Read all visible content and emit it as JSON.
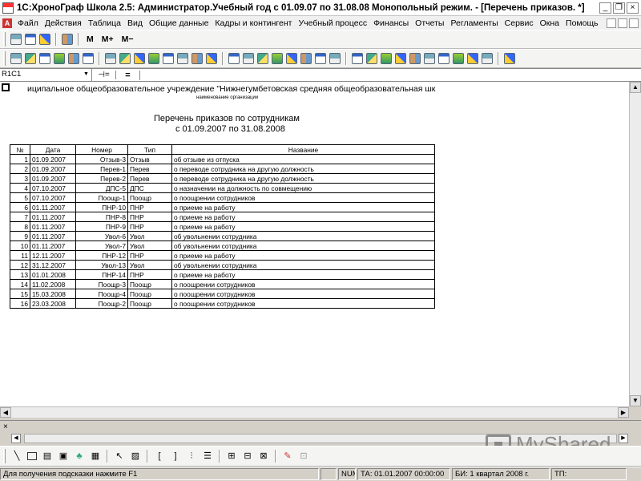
{
  "window": {
    "title": "1С:ХроноГраф Школа 2.5: Администратор.Учебный год с 01.09.07 по 31.08.08 Монопольный режим. - [Перечень приказов. *]",
    "minimize": "_",
    "restore": "❐",
    "close": "×"
  },
  "menu": {
    "items": [
      "Файл",
      "Действия",
      "Таблица",
      "Вид",
      "Общие данные",
      "Кадры и контингент",
      "Учебный процесс",
      "Финансы",
      "Отчеты",
      "Регламенты",
      "Сервис",
      "Окна",
      "Помощь"
    ],
    "doc_icon": "A"
  },
  "toolbar": {
    "m_label": "M",
    "m_plus_label": "M+",
    "m_minus_label": "M−"
  },
  "formula_bar": {
    "cell_ref": "R1C1",
    "pin": "⊣=",
    "equals": "="
  },
  "report": {
    "organization": "иципальное общеобразовательное учреждение \"Нижнегумбетовская средняя общеобразовательная шк",
    "organization_caption": "наименование организации",
    "title": "Перечень приказов по сотрудникам",
    "period": "с 01.09.2007 по 31.08.2008",
    "headers": [
      "№",
      "Дата",
      "Номер",
      "Тип",
      "Название"
    ],
    "rows": [
      [
        "1",
        "01.09.2007",
        "Отзыв-3",
        "Отзыв",
        "об отзыве из отпуска"
      ],
      [
        "2",
        "01.09.2007",
        "Перев-1",
        "Перев",
        "о переводе сотрудника на другую должность"
      ],
      [
        "3",
        "01.09.2007",
        "Перев-2",
        "Перев",
        "о переводе сотрудника на другую должность"
      ],
      [
        "4",
        "07.10.2007",
        "ДПС-5",
        "ДПС",
        "о назначении на должность по совмещению"
      ],
      [
        "5",
        "07.10.2007",
        "Поощр-1",
        "Поощр",
        "о поощрении сотрудников"
      ],
      [
        "6",
        "01.11.2007",
        "ПНР-10",
        "ПНР",
        "о приеме на работу"
      ],
      [
        "7",
        "01.11.2007",
        "ПНР-8",
        "ПНР",
        "о приеме на работу"
      ],
      [
        "8",
        "01.11.2007",
        "ПНР-9",
        "ПНР",
        "о приеме на работу"
      ],
      [
        "9",
        "01.11.2007",
        "Увол-6",
        "Увол",
        "об увольнении сотрудника"
      ],
      [
        "10",
        "01.11.2007",
        "Увол-7",
        "Увол",
        "об увольнении сотрудника"
      ],
      [
        "11",
        "12.11.2007",
        "ПНР-12",
        "ПНР",
        "о приеме на работу"
      ],
      [
        "12",
        "31.12.2007",
        "Увол-13",
        "Увол",
        "об увольнении сотрудника"
      ],
      [
        "13",
        "01.01.2008",
        "ПНР-14",
        "ПНР",
        "о приеме на работу"
      ],
      [
        "14",
        "11.02.2008",
        "Поощр-3",
        "Поощр",
        "о поощрении сотрудников"
      ],
      [
        "15",
        "15.03.2008",
        "Поощр-4",
        "Поощр",
        "о поощрении сотрудников"
      ],
      [
        "16",
        "23.03.2008",
        "Поощр-2",
        "Поощр",
        "о поощрении сотрудников"
      ]
    ]
  },
  "drawing_bar": {
    "bracket_open": "[",
    "bracket_close": "]"
  },
  "watermark": "MyShared",
  "status": {
    "hint": "Для получения подсказки нажмите F1",
    "num": "NUM",
    "ta": "ТА: 01.01.2007  00:00:00",
    "bi": "БИ: 1 квартал 2008 г.",
    "tp": "ТП:"
  }
}
